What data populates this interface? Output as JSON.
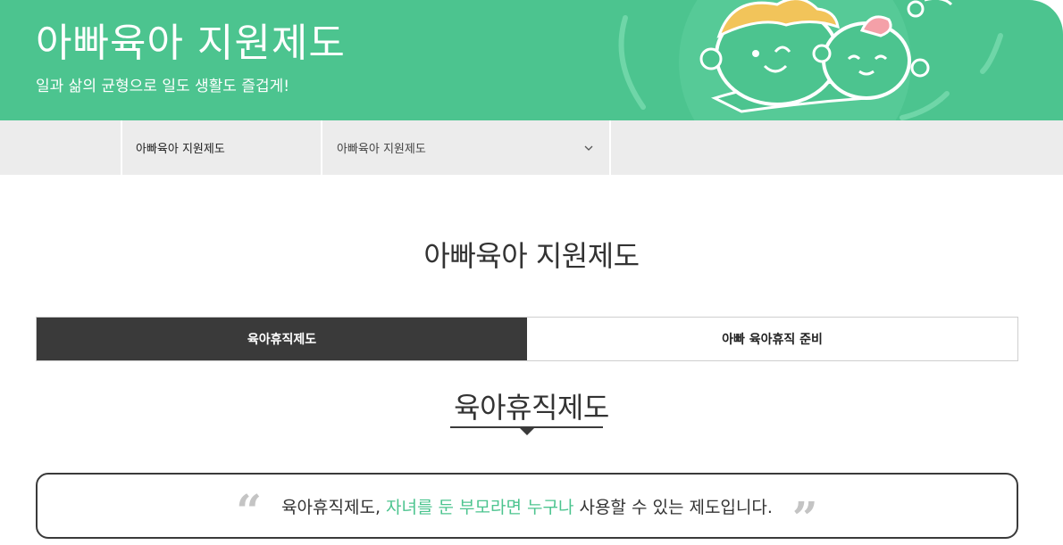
{
  "hero": {
    "title": "아빠육아 지원제도",
    "subtitle": "일과 삶의 균형으로 일도 생활도 즐겁게!",
    "background_color": "#4cc48f"
  },
  "subnav": {
    "home_label": "아빠육아 지원제도",
    "select_value": "아빠육아 지원제도",
    "select_icon": "chevron-down-icon"
  },
  "page": {
    "title": "아빠육아 지원제도"
  },
  "tabs": [
    {
      "label": "육아휴직제도",
      "active": true
    },
    {
      "label": "아빠 육아휴직 준비",
      "active": false
    }
  ],
  "section": {
    "heading": "육아휴직제도"
  },
  "quote": {
    "open_mark": "“",
    "close_mark": "”",
    "prefix": "육아휴직제도, ",
    "highlight": "자녀를 둔 부모라면 누구나",
    "suffix": " 사용할 수 있는 제도입니다.",
    "highlight_color": "#4cc48f"
  },
  "colors": {
    "accent": "#4cc48f",
    "dark": "#3a3a3a",
    "nav_bg": "#ececec"
  }
}
